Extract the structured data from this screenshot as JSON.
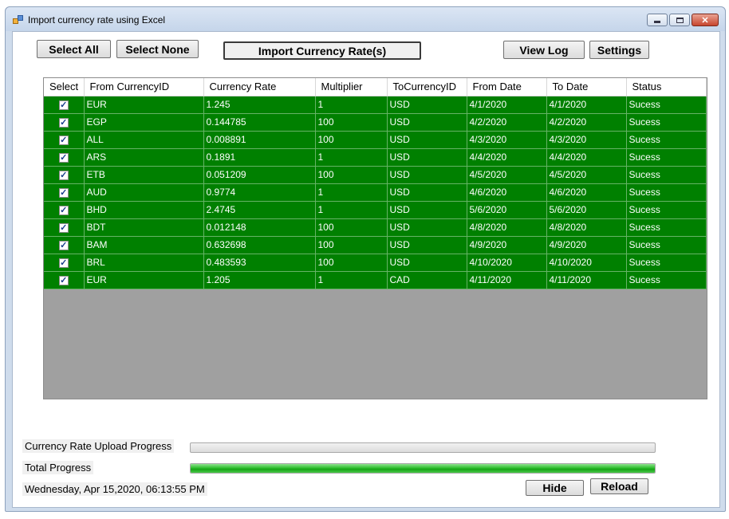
{
  "window": {
    "title": "Import currency rate using Excel",
    "controls": {
      "minimize": "",
      "maximize": "",
      "close": "✕"
    }
  },
  "toolbar": {
    "select_all": "Select All",
    "select_none": "Select None",
    "import": "Import Currency Rate(s)",
    "view_log": "View Log",
    "settings": "Settings"
  },
  "grid": {
    "columns": [
      "Select",
      "From CurrencyID",
      "Currency Rate",
      "Multiplier",
      "ToCurrencyID",
      "From Date",
      "To Date",
      "Status"
    ],
    "rows": [
      {
        "checked": true,
        "from": "EUR",
        "rate": "1.245",
        "multiplier": "1",
        "to": "USD",
        "from_date": "4/1/2020",
        "to_date": "4/1/2020",
        "status": "Sucess"
      },
      {
        "checked": true,
        "from": "EGP",
        "rate": "0.144785",
        "multiplier": "100",
        "to": "USD",
        "from_date": "4/2/2020",
        "to_date": "4/2/2020",
        "status": "Sucess"
      },
      {
        "checked": true,
        "from": "ALL",
        "rate": "0.008891",
        "multiplier": "100",
        "to": "USD",
        "from_date": "4/3/2020",
        "to_date": "4/3/2020",
        "status": "Sucess"
      },
      {
        "checked": true,
        "from": "ARS",
        "rate": "0.1891",
        "multiplier": "1",
        "to": "USD",
        "from_date": "4/4/2020",
        "to_date": "4/4/2020",
        "status": "Sucess"
      },
      {
        "checked": true,
        "from": "ETB",
        "rate": "0.051209",
        "multiplier": "100",
        "to": "USD",
        "from_date": "4/5/2020",
        "to_date": "4/5/2020",
        "status": "Sucess"
      },
      {
        "checked": true,
        "from": "AUD",
        "rate": "0.9774",
        "multiplier": "1",
        "to": "USD",
        "from_date": "4/6/2020",
        "to_date": "4/6/2020",
        "status": "Sucess"
      },
      {
        "checked": true,
        "from": "BHD",
        "rate": "2.4745",
        "multiplier": "1",
        "to": "USD",
        "from_date": "5/6/2020",
        "to_date": "5/6/2020",
        "status": "Sucess"
      },
      {
        "checked": true,
        "from": "BDT",
        "rate": "0.012148",
        "multiplier": "100",
        "to": "USD",
        "from_date": "4/8/2020",
        "to_date": "4/8/2020",
        "status": "Sucess"
      },
      {
        "checked": true,
        "from": "BAM",
        "rate": "0.632698",
        "multiplier": "100",
        "to": "USD",
        "from_date": "4/9/2020",
        "to_date": "4/9/2020",
        "status": "Sucess"
      },
      {
        "checked": true,
        "from": "BRL",
        "rate": "0.483593",
        "multiplier": "100",
        "to": "USD",
        "from_date": "4/10/2020",
        "to_date": "4/10/2020",
        "status": "Sucess"
      },
      {
        "checked": true,
        "from": "EUR",
        "rate": "1.205",
        "multiplier": "1",
        "to": "CAD",
        "from_date": "4/11/2020",
        "to_date": "4/11/2020",
        "status": "Sucess"
      }
    ]
  },
  "footer": {
    "upload_progress_label": "Currency Rate Upload Progress",
    "upload_progress_fraction": 0,
    "total_progress_label": "Total Progress",
    "total_progress_fraction": 1,
    "datetime": "Wednesday, Apr 15,2020, 06:13:55 PM",
    "hide": "Hide",
    "reload": "Reload"
  },
  "colors": {
    "row_background": "#008000",
    "grid_empty": "#a0a0a0",
    "progress_fill": "#16a316"
  }
}
